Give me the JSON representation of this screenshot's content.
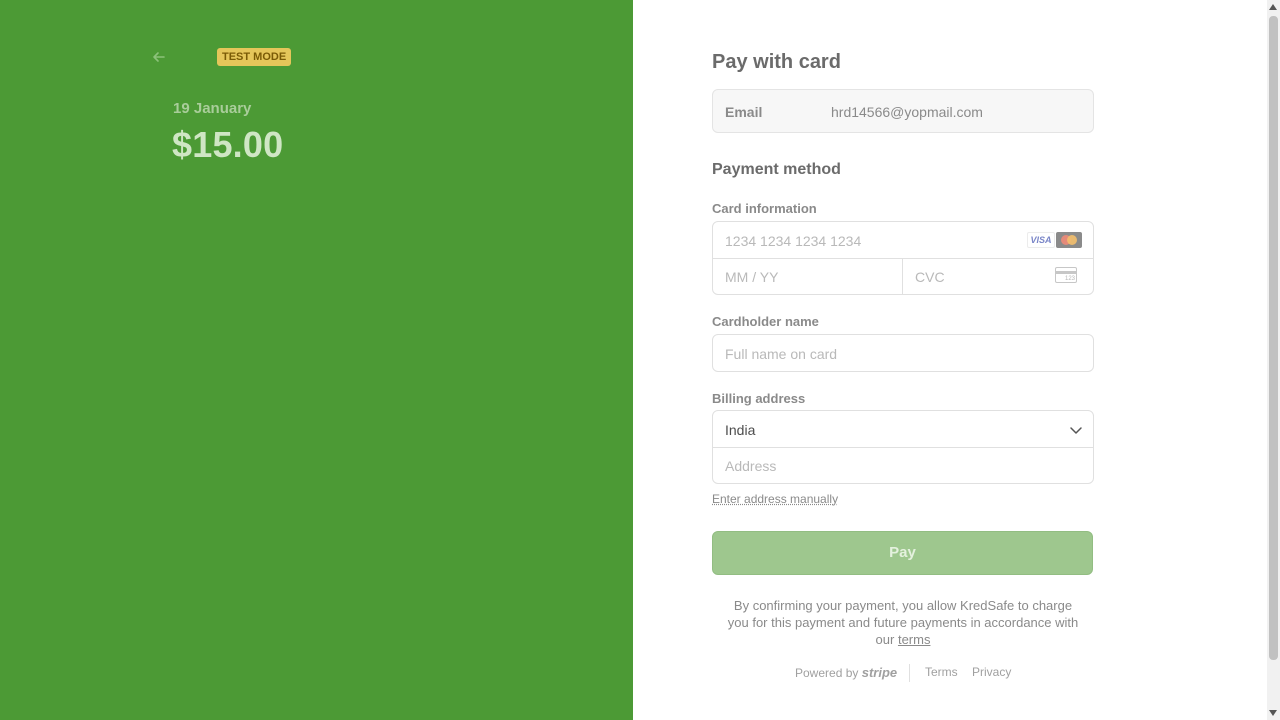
{
  "summary": {
    "test_mode_badge": "TEST MODE",
    "date": "19 January",
    "amount": "$15.00"
  },
  "form": {
    "title": "Pay with card",
    "email": {
      "label": "Email",
      "value": "hrd14566@yopmail.com"
    },
    "payment_method_heading": "Payment method",
    "card": {
      "label": "Card information",
      "number_placeholder": "1234 1234 1234 1234",
      "expiry_placeholder": "MM / YY",
      "cvc_placeholder": "CVC",
      "brand_visa": "VISA",
      "cvc_icon_text": "123"
    },
    "cardholder": {
      "label": "Cardholder name",
      "placeholder": "Full name on card"
    },
    "billing": {
      "label": "Billing address",
      "country": "India",
      "address_placeholder": "Address",
      "manual_link": "Enter address manually"
    },
    "pay_button": "Pay",
    "consent_text": "By confirming your payment, you allow KredSafe to charge you for this payment and future payments in accordance with our",
    "consent_terms": "terms"
  },
  "footer": {
    "powered_by": "Powered by",
    "brand": "stripe",
    "terms": "Terms",
    "privacy": "Privacy"
  },
  "colors": {
    "left_panel": "#4c9a35",
    "pay_button": "#9ec78e",
    "badge": "#e5c65a"
  }
}
